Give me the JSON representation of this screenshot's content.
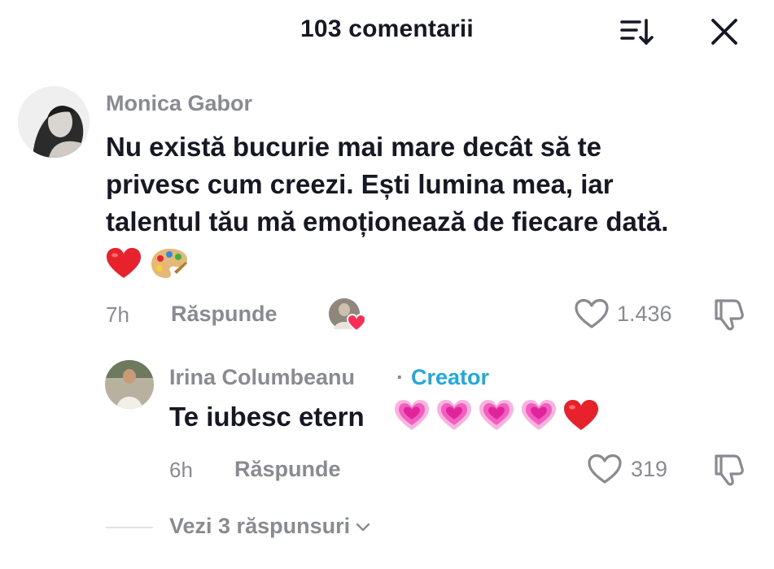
{
  "header": {
    "title": "103 comentarii",
    "sort_icon": "sort-icon",
    "close_icon": "close-icon"
  },
  "comment": {
    "username": "Monica Gabor",
    "text_lines": [
      "Nu există bucurie mai mare decât să te",
      "privesc cum creezi. Ești lumina mea, iar",
      "talentul tău mă emoționează de fiecare dată."
    ],
    "emojis": [
      "red-heart-emoji",
      "artist-palette-emoji"
    ],
    "time": "7h",
    "reply_label": "Răspunde",
    "likes": "1.436",
    "liked_by_creator": true
  },
  "reply": {
    "username": "Irina Columbeanu",
    "separator": "·",
    "badge": "Creator",
    "text": "Te iubesc etern",
    "emojis": [
      "growing-heart-emoji",
      "growing-heart-emoji",
      "growing-heart-emoji",
      "growing-heart-emoji",
      "red-heart-emoji"
    ],
    "time": "6h",
    "reply_label": "Răspunde",
    "likes": "319"
  },
  "view_replies": {
    "label": "Vezi 3 răspunsuri"
  },
  "colors": {
    "text": "#161823",
    "muted": "#8a8b91",
    "creator": "#20a9e0",
    "heart_red": "#e8222c",
    "heart_pink": "#f25ebf"
  }
}
